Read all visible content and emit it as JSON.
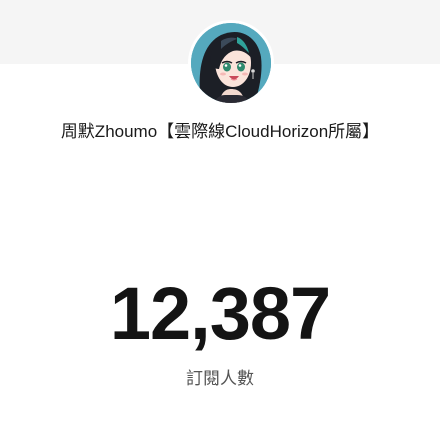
{
  "channel": {
    "name": "周默Zhoumo【雲際線CloudHorizon所屬】",
    "avatar_icon": "vtuber-avatar"
  },
  "stats": {
    "subscriber_count": "12,387",
    "subscriber_label": "訂閱人數"
  },
  "colors": {
    "header_band": "#f5f5f5",
    "avatar_background": "#55a9be",
    "count_text": "#141414",
    "label_text": "#555555"
  }
}
